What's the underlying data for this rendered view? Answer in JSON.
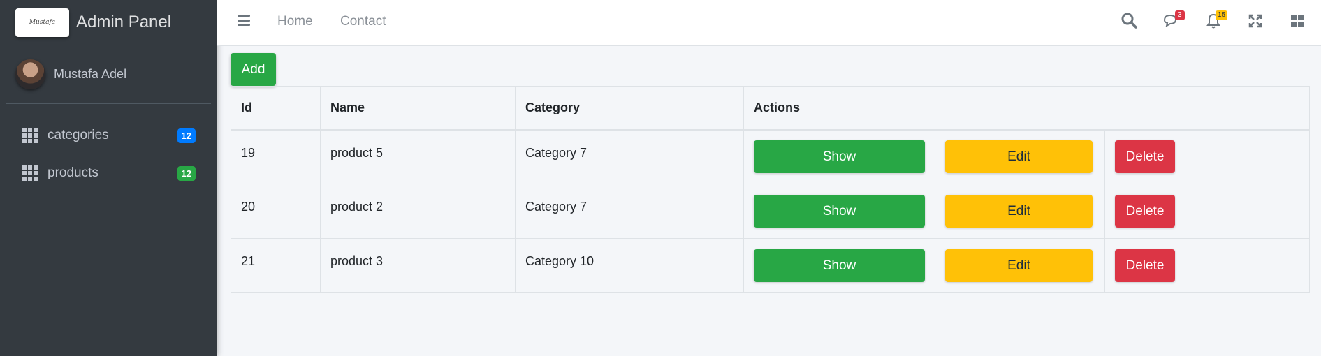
{
  "brand": {
    "logo_text": "Mustafa",
    "title": "Admin Panel"
  },
  "user": {
    "name": "Mustafa Adel"
  },
  "sidebar": {
    "items": [
      {
        "label": "categories",
        "badge": "12",
        "badge_color": "#007bff",
        "icon": "grid-icon"
      },
      {
        "label": "products",
        "badge": "12",
        "badge_color": "#28a745",
        "icon": "grid-icon"
      }
    ]
  },
  "navbar": {
    "links": [
      "Home",
      "Contact"
    ],
    "messages_count": "3",
    "notifications_count": "15",
    "icons": [
      "menu-icon",
      "search-icon",
      "comments-icon",
      "bell-icon",
      "fullscreen-icon",
      "grid-layout-icon"
    ]
  },
  "main": {
    "add_label": "Add",
    "table": {
      "headers": [
        "Id",
        "Name",
        "Category",
        "Actions"
      ],
      "rows": [
        {
          "id": "19",
          "name": "product 5",
          "category": "Category 7"
        },
        {
          "id": "20",
          "name": "product 2",
          "category": "Category 7"
        },
        {
          "id": "21",
          "name": "product 3",
          "category": "Category 10"
        }
      ],
      "actions": {
        "show": "Show",
        "edit": "Edit",
        "delete": "Delete"
      }
    }
  },
  "colors": {
    "sidebar_bg": "#343a40",
    "success": "#28a745",
    "warning": "#ffc107",
    "danger": "#dc3545",
    "primary": "#007bff"
  }
}
